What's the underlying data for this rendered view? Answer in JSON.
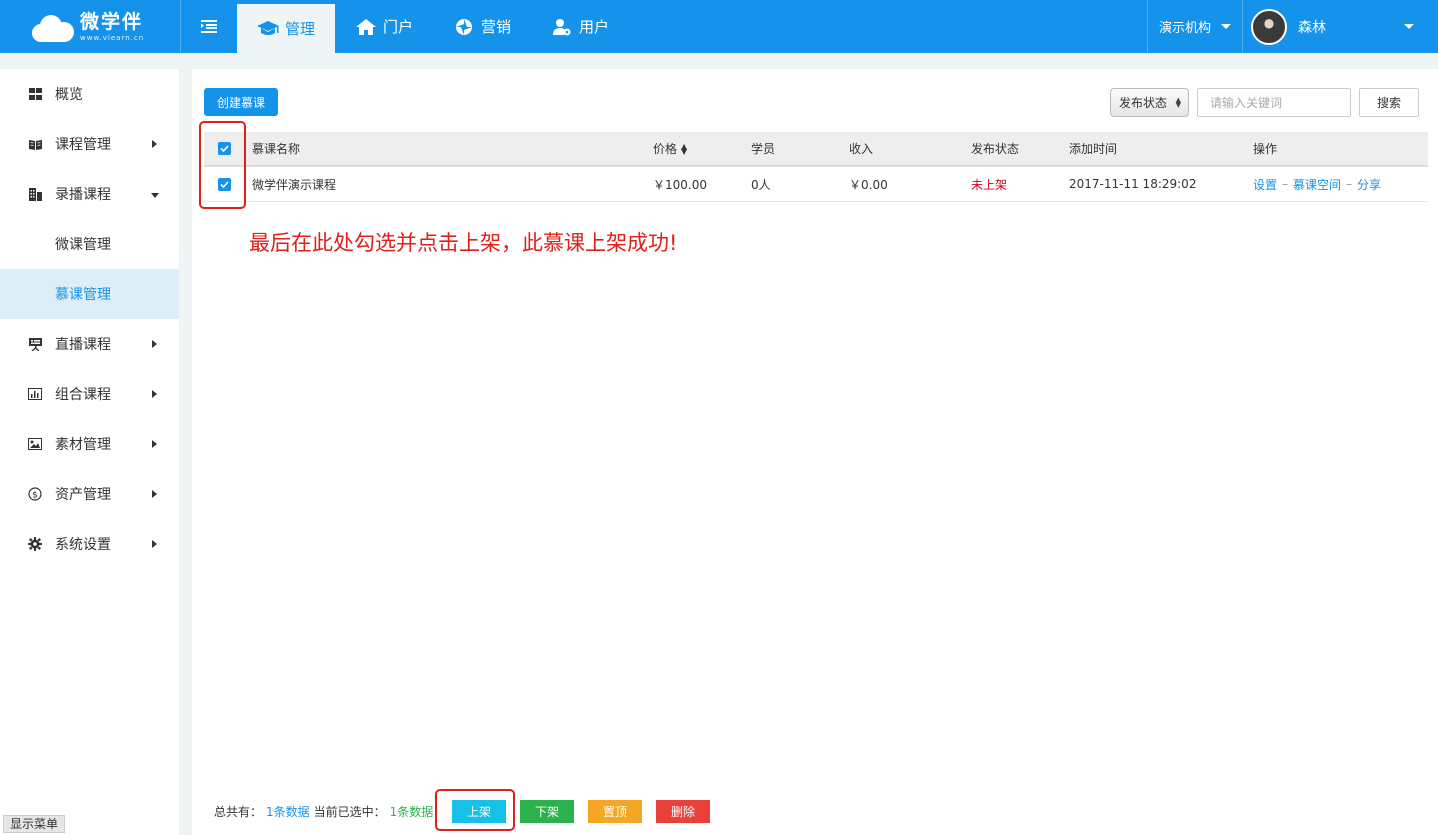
{
  "brand": {
    "name": "微学伴",
    "domain": "www.viearn.cn"
  },
  "nav": [
    {
      "label": "管理",
      "icon": "graduation-cap-icon",
      "active": true
    },
    {
      "label": "门户",
      "icon": "home-icon",
      "active": false
    },
    {
      "label": "营销",
      "icon": "aperture-icon",
      "active": false
    },
    {
      "label": "用户",
      "icon": "user-gear-icon",
      "active": false
    }
  ],
  "org": {
    "label": "演示机构"
  },
  "user": {
    "name": "森林"
  },
  "sidebar": {
    "items": [
      {
        "label": "概览",
        "icon": "grid-icon"
      },
      {
        "label": "课程管理",
        "icon": "book-icon"
      },
      {
        "label": "录播课程",
        "icon": "building-icon",
        "expanded": true,
        "children": [
          {
            "label": "微课管理"
          },
          {
            "label": "慕课管理",
            "active": true
          }
        ]
      },
      {
        "label": "直播课程",
        "icon": "presentation-icon"
      },
      {
        "label": "组合课程",
        "icon": "bar-chart-icon"
      },
      {
        "label": "素材管理",
        "icon": "image-icon"
      },
      {
        "label": "资产管理",
        "icon": "dollar-circle-icon"
      },
      {
        "label": "系统设置",
        "icon": "gear-icon"
      }
    ],
    "show_menu_label": "显示菜单"
  },
  "toolbar": {
    "create_label": "创建慕课",
    "status_select": "发布状态",
    "search_placeholder": "请输入关键词",
    "search_label": "搜索"
  },
  "table": {
    "headers": {
      "name": "慕课名称",
      "price": "价格",
      "students": "学员",
      "income": "收入",
      "status": "发布状态",
      "added": "添加时间",
      "ops": "操作"
    },
    "rows": [
      {
        "checked": true,
        "name": "微学伴演示课程",
        "price": "￥100.00",
        "students": "0人",
        "income": "￥0.00",
        "status": "未上架",
        "added": "2017-11-11 18:29:02",
        "ops": [
          "设置",
          "慕课空间",
          "分享"
        ]
      }
    ]
  },
  "annotation": "最后在此处勾选并点击上架，此慕课上架成功!",
  "footer": {
    "total_prefix": "总共有：",
    "total_count": "1条数据",
    "selected_prefix": "当前已选中：",
    "selected_count": "1条数据",
    "buttons": [
      {
        "label": "上架",
        "color": "#16c0e6"
      },
      {
        "label": "下架",
        "color": "#2bb24c"
      },
      {
        "label": "置顶",
        "color": "#f5a623"
      },
      {
        "label": "删除",
        "color": "#e8413c"
      }
    ]
  },
  "colors": {
    "primary": "#1593ea",
    "annotation": "#e0201a",
    "status_unpublished": "#d0021b"
  }
}
